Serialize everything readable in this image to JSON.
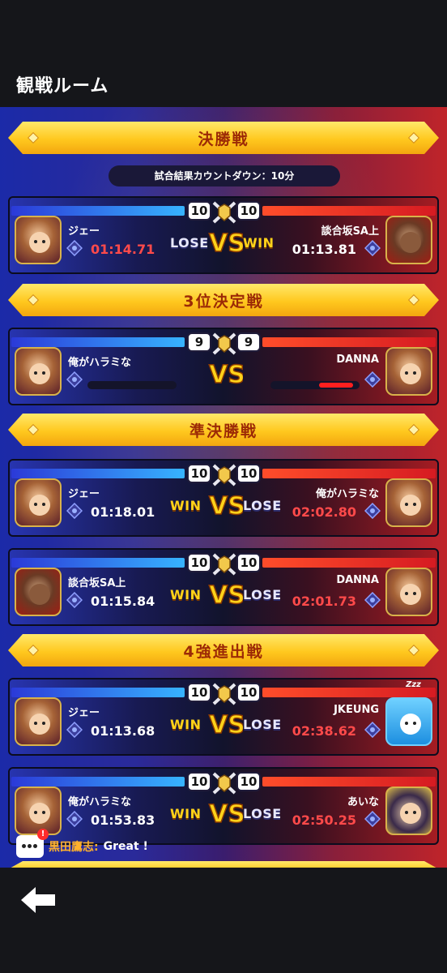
{
  "header": {
    "title": "観戦ルーム"
  },
  "final": {
    "banner": "決勝戦",
    "countdown": "試合結果カウントダウン：10分",
    "match": {
      "score_left": "10",
      "score_right": "10",
      "left_name": "ジェー",
      "left_time": "01:14.71",
      "left_result": "LOSE",
      "right_name": "談合坂SA上",
      "right_time": "01:13.81",
      "right_result": "WIN"
    }
  },
  "third_place": {
    "banner": "3位決定戦",
    "match": {
      "score_left": "9",
      "score_right": "9",
      "left_name": "俺がハラミな",
      "right_name": "DANNA"
    }
  },
  "semifinal": {
    "banner": "準決勝戦",
    "matches": [
      {
        "score_left": "10",
        "score_right": "10",
        "left_name": "ジェー",
        "left_time": "01:18.01",
        "left_result": "WIN",
        "right_name": "俺がハラミな",
        "right_time": "02:02.80",
        "right_result": "LOSE"
      },
      {
        "score_left": "10",
        "score_right": "10",
        "left_name": "談合坂SA上",
        "left_time": "01:15.84",
        "left_result": "WIN",
        "right_name": "DANNA",
        "right_time": "02:01.73",
        "right_result": "LOSE"
      }
    ]
  },
  "quarterfinal": {
    "banner": "4強進出戦",
    "matches": [
      {
        "score_left": "10",
        "score_right": "10",
        "left_name": "ジェー",
        "left_time": "01:13.68",
        "left_result": "WIN",
        "right_name": "JKEUNG",
        "right_time": "02:38.62",
        "right_result": "LOSE",
        "right_status": "Zzz"
      },
      {
        "score_left": "10",
        "score_right": "10",
        "left_name": "俺がハラミな",
        "left_time": "01:53.83",
        "left_result": "WIN",
        "right_name": "あいな",
        "right_time": "02:50.25",
        "right_result": "LOSE"
      }
    ]
  },
  "chat": {
    "badge": "!",
    "user": "黒田鷹志:",
    "message": "Great !"
  },
  "icons": {
    "back": "back-arrow-icon",
    "crest": "crossed-swords-crest-icon",
    "vs": "vs-emblem-icon",
    "rank": "rank-badge-icon",
    "chat": "chat-bubble-icon"
  },
  "colors": {
    "banner": "#ffc81e",
    "win": "#ffd31a",
    "loser_time": "#ff4a4a",
    "blue_side": "#2b3ad8",
    "red_side": "#d61b22"
  }
}
